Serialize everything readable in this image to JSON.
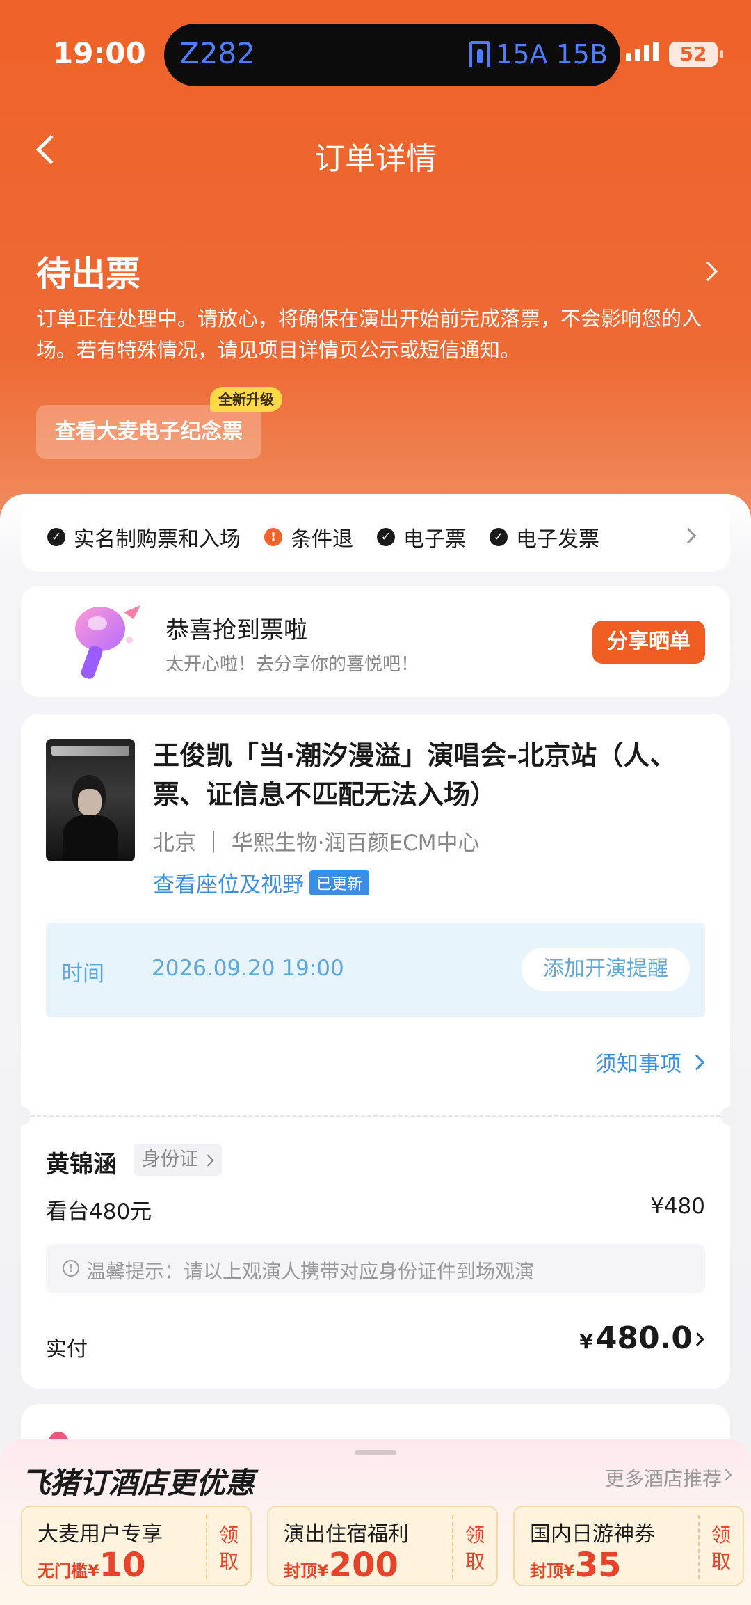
{
  "status_bar": {
    "time": "19:00",
    "island_train": "Z282",
    "island_seats": "15A 15B",
    "battery": "52"
  },
  "nav": {
    "title": "订单详情"
  },
  "order": {
    "status": "待出票",
    "description": "订单正在处理中。请放心，将确保在演出开始前完成落票，不会影响您的入场。若有特殊情况，请见项目详情页公示或短信通知。",
    "souvenir_button": "查看大麦电子纪念票",
    "new_badge": "全新升级"
  },
  "features": [
    {
      "label": "实名制购票和入场",
      "icon": "check-icon"
    },
    {
      "label": "条件退",
      "icon": "warning-icon"
    },
    {
      "label": "电子票",
      "icon": "check-icon"
    },
    {
      "label": "电子发票",
      "icon": "check-icon"
    }
  ],
  "share": {
    "title": "恭喜抢到票啦",
    "subtitle": "太开心啦！去分享你的喜悦吧！",
    "button": "分享晒单"
  },
  "event": {
    "title": "王俊凯「当·潮汐漫溢」演唱会-北京站（人、票、证信息不匹配无法入场）",
    "venue": "北京 ｜ 华熙生物·润百颜ECM中心",
    "seat_link": "查看座位及视野",
    "updated_badge": "已更新",
    "time_label": "时间",
    "time_value": "2026.09.20 19:00",
    "remind_button": "添加开演提醒",
    "notice_link": "须知事项"
  },
  "attendee": {
    "name": "黄锦涵",
    "id_type": "身份证",
    "ticket_type": "看台480元",
    "ticket_price": "¥480",
    "tip": "温馨提示：请以上观演人携带对应身份证件到场观演",
    "paid_label": "实付",
    "paid_currency": "¥",
    "paid_amount": "480.0"
  },
  "hotel": {
    "title": "飞猪订酒店更优惠",
    "more": "更多酒店推荐",
    "coupons": [
      {
        "name": "大麦用户专享",
        "prefix": "无门槛¥",
        "value": "10",
        "claim": "领取"
      },
      {
        "name": "演出住宿福利",
        "prefix": "封顶¥",
        "value": "200",
        "claim": "领取"
      },
      {
        "name": "国内日游神券",
        "prefix": "封顶¥",
        "value": "35",
        "claim": "领取"
      }
    ]
  },
  "colors": {
    "brand_orange": "#ef6229",
    "link_blue": "#3a8ee6",
    "coupon_red": "#e8432a"
  }
}
